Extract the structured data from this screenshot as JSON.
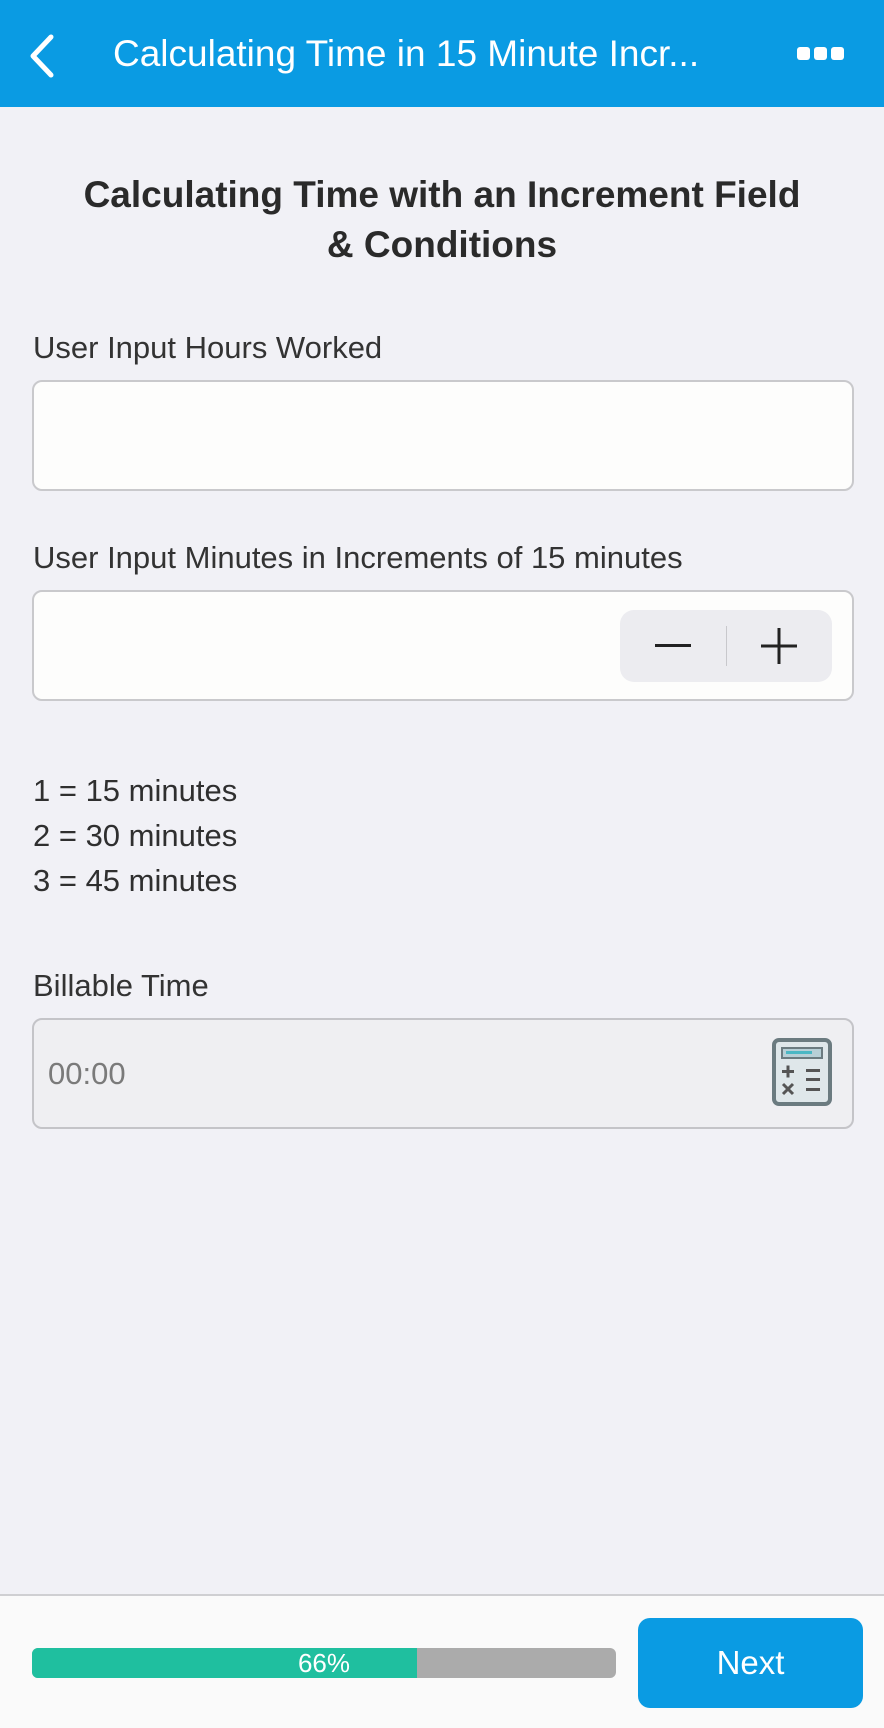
{
  "header": {
    "title": "Calculating Time in 15 Minute Incr...",
    "back_icon": "chevron-left-icon",
    "more_icon": "more-dots-icon",
    "color": "#0a9be3"
  },
  "page": {
    "title_line1": "Calculating Time with an Increment Field",
    "title_line2": "& Conditions"
  },
  "fields": {
    "hours": {
      "label": "User Input Hours Worked",
      "value": ""
    },
    "minutes": {
      "label": "User Input Minutes in Increments of 15 minutes",
      "value": ""
    },
    "billable": {
      "label": "Billable Time",
      "value": "00:00"
    }
  },
  "info_lines": [
    "1 = 15 minutes",
    "2 = 30 minutes",
    "3 = 45 minutes"
  ],
  "footer": {
    "progress_label": "66%",
    "progress_fraction": 0.66,
    "progress_color": "#1fbf9f",
    "next_label": "Next"
  }
}
